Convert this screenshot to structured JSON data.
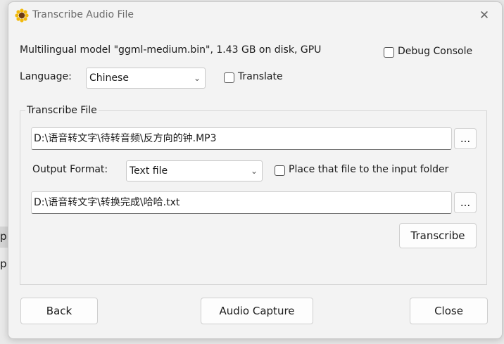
{
  "window": {
    "title": "Transcribe Audio File",
    "close_glyph": "✕"
  },
  "model_info": "Multilingual model \"ggml-medium.bin\", 1.43 GB on disk, GPU",
  "debug_console": {
    "label": "Debug Console",
    "checked": false
  },
  "language": {
    "label": "Language:",
    "selected": "Chinese",
    "translate_label": "Translate",
    "translate_checked": false
  },
  "transcribe_file": {
    "group_title": "Transcribe File",
    "input_path": "D:\\语音转文字\\待转音频\\反方向的钟.MP3",
    "browse_label": "...",
    "output_format_label": "Output Format:",
    "output_format_selected": "Text file",
    "place_in_input_folder_label": "Place that file to the input folder",
    "place_in_input_folder_checked": false,
    "output_path": "D:\\语音转文字\\转换完成\\哈哈.txt",
    "browse2_label": "...",
    "transcribe_label": "Transcribe"
  },
  "footer": {
    "back_label": "Back",
    "audio_capture_label": "Audio Capture",
    "close_label": "Close"
  },
  "background": {
    "fragment_1": "p",
    "fragment_2": "p"
  },
  "colors": {
    "dialog_bg": "#f3f3f3",
    "icon_sunflower": "#f2b90c"
  }
}
